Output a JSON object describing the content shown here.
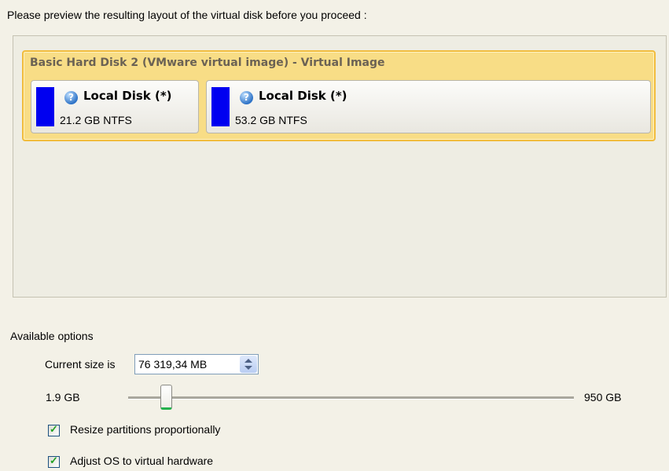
{
  "header": {
    "instruction": "Please preview the resulting layout of the virtual disk before you proceed :"
  },
  "disk": {
    "title": "Basic Hard Disk 2 (VMware virtual image) - Virtual Image",
    "partitions": [
      {
        "label": "Local Disk (*)",
        "size": "21.2 GB NTFS",
        "color": "#0000f0",
        "icon": "info-icon"
      },
      {
        "label": "Local Disk (*)",
        "size": "53.2 GB NTFS",
        "color": "#0000f0",
        "icon": "info-icon"
      }
    ]
  },
  "options": {
    "title": "Available options",
    "size_label": "Current size is",
    "size_value": "76 319,34 MB",
    "slider": {
      "min_label": "1.9 GB",
      "max_label": "950 GB",
      "position_fraction": 0.08
    },
    "checkboxes": [
      {
        "label": "Resize partitions proportionally",
        "checked": true
      },
      {
        "label": "Adjust OS to virtual hardware",
        "checked": true
      }
    ]
  },
  "colors": {
    "card_border": "#f1bc3c",
    "card_fill": "#f8dd86",
    "partition_bar": "#0000f0",
    "check": "#21a121"
  }
}
